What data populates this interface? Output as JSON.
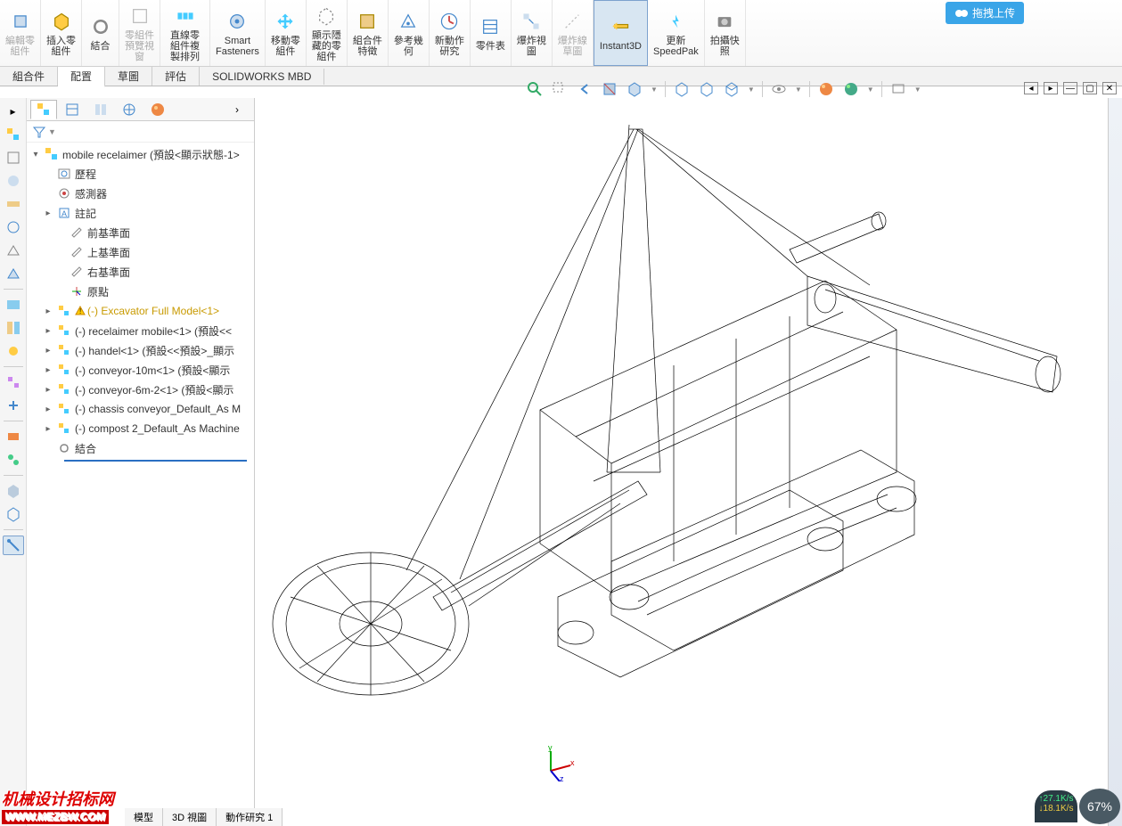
{
  "ribbon": [
    {
      "id": "edit-component",
      "label": "編輯零\n組件",
      "disabled": true
    },
    {
      "id": "insert-component",
      "label": "插入零\n組件"
    },
    {
      "id": "mate",
      "label": "結合"
    },
    {
      "id": "component-preview",
      "label": "零組件\n預覽視\n窗",
      "disabled": true
    },
    {
      "id": "linear-pattern",
      "label": "直線零\n組件複\n製排列"
    },
    {
      "id": "smart-fasteners",
      "label": "Smart\nFasteners"
    },
    {
      "id": "move-component",
      "label": "移動零\n組件"
    },
    {
      "id": "show-hidden",
      "label": "顯示隱\n藏的零\n組件"
    },
    {
      "id": "assembly-features",
      "label": "組合件\n特徵"
    },
    {
      "id": "reference-geom",
      "label": "參考幾\n何"
    },
    {
      "id": "new-motion",
      "label": "新動作\n研究"
    },
    {
      "id": "bom",
      "label": "零件表"
    },
    {
      "id": "exploded-view",
      "label": "爆炸視\n圖"
    },
    {
      "id": "explode-line",
      "label": "爆炸線\n草圖",
      "disabled": true
    },
    {
      "id": "instant3d",
      "label": "Instant3D",
      "active": true
    },
    {
      "id": "speedpak",
      "label": "更新\nSpeedPak"
    },
    {
      "id": "snapshot",
      "label": "拍攝快\n照"
    }
  ],
  "tabs": [
    {
      "id": "assembly",
      "label": "組合件"
    },
    {
      "id": "layout",
      "label": "配置",
      "active": true
    },
    {
      "id": "sketch",
      "label": "草圖"
    },
    {
      "id": "evaluate",
      "label": "評估"
    },
    {
      "id": "mbd",
      "label": "SOLIDWORKS MBD"
    }
  ],
  "upload_label": "拖拽上传",
  "tree": {
    "root": "mobile recelaimer (預設<顯示狀態-1>",
    "items": [
      {
        "icon": "history",
        "label": "歷程",
        "indent": 1
      },
      {
        "icon": "sensor",
        "label": "感測器",
        "indent": 1
      },
      {
        "icon": "annot",
        "label": "註記",
        "indent": 1,
        "arrow": true
      },
      {
        "icon": "plane",
        "label": "前基準面",
        "indent": 2
      },
      {
        "icon": "plane",
        "label": "上基準面",
        "indent": 2
      },
      {
        "icon": "plane",
        "label": "右基準面",
        "indent": 2
      },
      {
        "icon": "origin",
        "label": "原點",
        "indent": 2
      },
      {
        "icon": "asm",
        "label": "(-) Excavator Full Model<1>",
        "indent": 1,
        "arrow": true,
        "warn": true
      },
      {
        "icon": "asm",
        "label": "(-) recelaimer mobile<1> (預設<<",
        "indent": 1,
        "arrow": true
      },
      {
        "icon": "asm",
        "label": "(-) handel<1> (預設<<預設>_顯示",
        "indent": 1,
        "arrow": true
      },
      {
        "icon": "asm",
        "label": "(-) conveyor-10m<1> (預設<顯示",
        "indent": 1,
        "arrow": true
      },
      {
        "icon": "asm",
        "label": "(-) conveyor-6m-2<1> (預設<顯示",
        "indent": 1,
        "arrow": true
      },
      {
        "icon": "asm",
        "label": "(-) chassis conveyor_Default_As M",
        "indent": 1,
        "arrow": true
      },
      {
        "icon": "asm",
        "label": "(-) compost 2_Default_As Machine",
        "indent": 1,
        "arrow": true
      },
      {
        "icon": "mate",
        "label": "結合",
        "indent": 1
      }
    ]
  },
  "bottom_tabs": [
    "模型",
    "3D 視圖",
    "動作研究 1"
  ],
  "triad": {
    "x": "x",
    "y": "y",
    "z": "z"
  },
  "watermark": {
    "line1": "机械设计招标网",
    "line2": "WWW.MEZBW.COM"
  },
  "net": {
    "up": "27.1K/s",
    "down": "18.1K/s"
  },
  "zoom": "67%"
}
